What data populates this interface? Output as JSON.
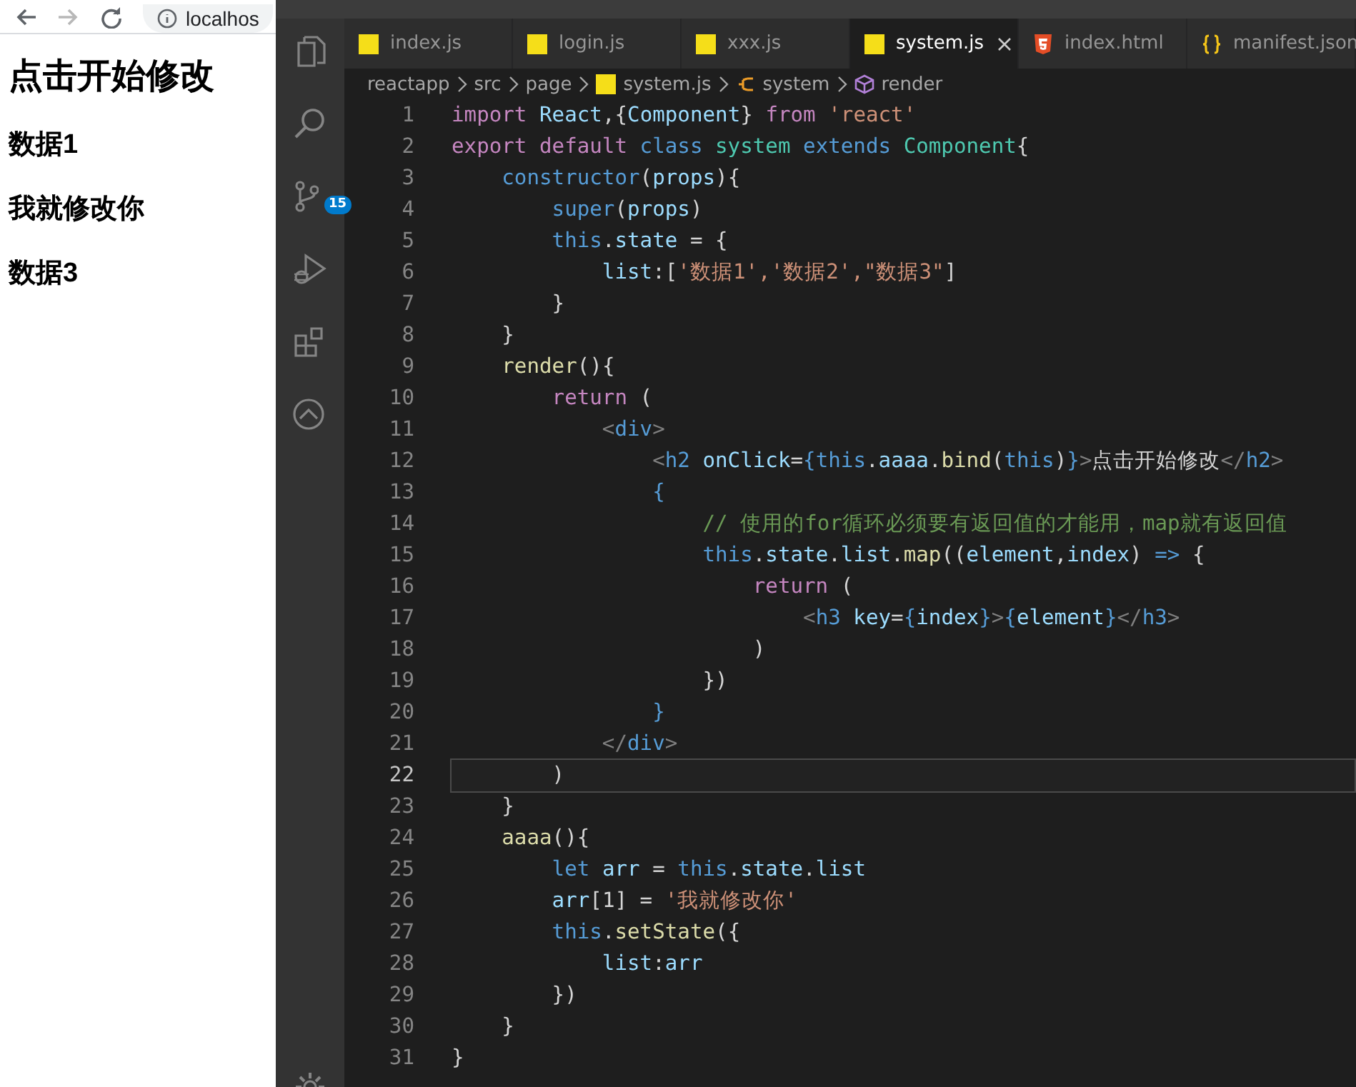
{
  "browser": {
    "nav_buttons": [
      {
        "kind": "back",
        "disabled": false
      },
      {
        "kind": "forward",
        "disabled": true
      },
      {
        "kind": "reload",
        "disabled": false
      }
    ],
    "address": "localhos",
    "heading": "点击开始修改",
    "items": [
      "数据1",
      "我就修改你",
      "数据3"
    ]
  },
  "editor": {
    "activity_bar": {
      "items": [
        {
          "kind": "files"
        },
        {
          "kind": "search"
        },
        {
          "kind": "git",
          "badge": "15"
        },
        {
          "kind": "debug"
        },
        {
          "kind": "extensions"
        },
        {
          "kind": "remote"
        }
      ]
    },
    "tabs": [
      {
        "label": "index.js",
        "kind": "js",
        "selected": false
      },
      {
        "label": "login.js",
        "kind": "js",
        "selected": false
      },
      {
        "label": "xxx.js",
        "kind": "js",
        "selected": false
      },
      {
        "label": "system.js",
        "kind": "js",
        "selected": true
      },
      {
        "label": "index.html",
        "kind": "html",
        "selected": false
      },
      {
        "label": "manifest.json",
        "kind": "json",
        "selected": false
      }
    ],
    "breadcrumb": [
      {
        "label": "reactapp",
        "kind": "folder"
      },
      {
        "label": "src",
        "kind": "folder"
      },
      {
        "label": "page",
        "kind": "folder"
      },
      {
        "label": "system.js",
        "kind": "js"
      },
      {
        "label": "system",
        "kind": "class"
      },
      {
        "label": "render",
        "kind": "method"
      }
    ],
    "lines": [
      {
        "number": "1",
        "current": false,
        "tokens": [
          {
            "text": "import ",
            "kind": "kw"
          },
          {
            "text": "React",
            "kind": "var"
          },
          {
            "text": ",{",
            "kind": "p"
          },
          {
            "text": "Component",
            "kind": "var"
          },
          {
            "text": "} ",
            "kind": "p"
          },
          {
            "text": "from ",
            "kind": "kw"
          },
          {
            "text": "'react'",
            "kind": "str"
          }
        ]
      },
      {
        "number": "2",
        "current": false,
        "tokens": [
          {
            "text": "export default ",
            "kind": "kw"
          },
          {
            "text": "class ",
            "kind": "st"
          },
          {
            "text": "system ",
            "kind": "type"
          },
          {
            "text": "extends ",
            "kind": "st"
          },
          {
            "text": "Component",
            "kind": "type"
          },
          {
            "text": "{",
            "kind": "p"
          }
        ]
      },
      {
        "number": "3",
        "current": false,
        "tokens": [
          {
            "text": "    constructor",
            "kind": "st"
          },
          {
            "text": "(",
            "kind": "p"
          },
          {
            "text": "props",
            "kind": "var"
          },
          {
            "text": "){",
            "kind": "p"
          }
        ]
      },
      {
        "number": "4",
        "current": false,
        "tokens": [
          {
            "text": "        super",
            "kind": "st"
          },
          {
            "text": "(",
            "kind": "p"
          },
          {
            "text": "props",
            "kind": "var"
          },
          {
            "text": ")",
            "kind": "p"
          }
        ]
      },
      {
        "number": "5",
        "current": false,
        "tokens": [
          {
            "text": "        this",
            "kind": "st"
          },
          {
            "text": ".",
            "kind": "p"
          },
          {
            "text": "state",
            "kind": "var"
          },
          {
            "text": " = {",
            "kind": "p"
          }
        ]
      },
      {
        "number": "6",
        "current": false,
        "tokens": [
          {
            "text": "            list",
            "kind": "var"
          },
          {
            "text": ":[",
            "kind": "p"
          },
          {
            "text": "'数据1','数据2',\"数据3\"",
            "kind": "str"
          },
          {
            "text": "]",
            "kind": "p"
          }
        ]
      },
      {
        "number": "7",
        "current": false,
        "tokens": [
          {
            "text": "        }",
            "kind": "p"
          }
        ]
      },
      {
        "number": "8",
        "current": false,
        "tokens": [
          {
            "text": "    }",
            "kind": "p"
          }
        ]
      },
      {
        "number": "9",
        "current": false,
        "tokens": [
          {
            "text": "    render",
            "kind": "fn"
          },
          {
            "text": "(){",
            "kind": "p"
          }
        ]
      },
      {
        "number": "10",
        "current": false,
        "tokens": [
          {
            "text": "        return",
            "kind": "kw"
          },
          {
            "text": " (",
            "kind": "p"
          }
        ]
      },
      {
        "number": "11",
        "current": false,
        "tokens": [
          {
            "text": "            <",
            "kind": "tag"
          },
          {
            "text": "div",
            "kind": "st"
          },
          {
            "text": ">",
            "kind": "tag"
          }
        ]
      },
      {
        "number": "12",
        "current": false,
        "tokens": [
          {
            "text": "                <",
            "kind": "tag"
          },
          {
            "text": "h2 ",
            "kind": "st"
          },
          {
            "text": "onClick",
            "kind": "var"
          },
          {
            "text": "=",
            "kind": "p"
          },
          {
            "text": "{this",
            "kind": "st"
          },
          {
            "text": ".",
            "kind": "p"
          },
          {
            "text": "aaaa",
            "kind": "var"
          },
          {
            "text": ".",
            "kind": "p"
          },
          {
            "text": "bind",
            "kind": "fn"
          },
          {
            "text": "(",
            "kind": "p"
          },
          {
            "text": "this",
            "kind": "st"
          },
          {
            "text": ")",
            "kind": "p"
          },
          {
            "text": "}",
            "kind": "st"
          },
          {
            "text": ">",
            "kind": "tag"
          },
          {
            "text": "点击开始修改",
            "kind": "p"
          },
          {
            "text": "</",
            "kind": "tag"
          },
          {
            "text": "h2",
            "kind": "st"
          },
          {
            "text": ">",
            "kind": "tag"
          }
        ]
      },
      {
        "number": "13",
        "current": false,
        "tokens": [
          {
            "text": "                {",
            "kind": "st"
          }
        ]
      },
      {
        "number": "14",
        "current": false,
        "tokens": [
          {
            "text": "                    // 使用的for循环必须要有返回值的才能用，map就有返回值",
            "kind": "cm"
          }
        ]
      },
      {
        "number": "15",
        "current": false,
        "tokens": [
          {
            "text": "                    this",
            "kind": "st"
          },
          {
            "text": ".",
            "kind": "p"
          },
          {
            "text": "state",
            "kind": "var"
          },
          {
            "text": ".",
            "kind": "p"
          },
          {
            "text": "list",
            "kind": "var"
          },
          {
            "text": ".",
            "kind": "p"
          },
          {
            "text": "map",
            "kind": "fn"
          },
          {
            "text": "((",
            "kind": "p"
          },
          {
            "text": "element",
            "kind": "var"
          },
          {
            "text": ",",
            "kind": "p"
          },
          {
            "text": "index",
            "kind": "var"
          },
          {
            "text": ") ",
            "kind": "p"
          },
          {
            "text": "=>",
            "kind": "st"
          },
          {
            "text": " {",
            "kind": "p"
          }
        ]
      },
      {
        "number": "16",
        "current": false,
        "tokens": [
          {
            "text": "                        return",
            "kind": "kw"
          },
          {
            "text": " (",
            "kind": "p"
          }
        ]
      },
      {
        "number": "17",
        "current": false,
        "tokens": [
          {
            "text": "                            <",
            "kind": "tag"
          },
          {
            "text": "h3 ",
            "kind": "st"
          },
          {
            "text": "key",
            "kind": "var"
          },
          {
            "text": "=",
            "kind": "p"
          },
          {
            "text": "{",
            "kind": "st"
          },
          {
            "text": "index",
            "kind": "var"
          },
          {
            "text": "}",
            "kind": "st"
          },
          {
            "text": ">",
            "kind": "tag"
          },
          {
            "text": "{",
            "kind": "st"
          },
          {
            "text": "element",
            "kind": "var"
          },
          {
            "text": "}",
            "kind": "st"
          },
          {
            "text": "</",
            "kind": "tag"
          },
          {
            "text": "h3",
            "kind": "st"
          },
          {
            "text": ">",
            "kind": "tag"
          }
        ]
      },
      {
        "number": "18",
        "current": false,
        "tokens": [
          {
            "text": "                        )",
            "kind": "p"
          }
        ]
      },
      {
        "number": "19",
        "current": false,
        "tokens": [
          {
            "text": "                    })",
            "kind": "p"
          }
        ]
      },
      {
        "number": "20",
        "current": false,
        "tokens": [
          {
            "text": "                }",
            "kind": "st"
          }
        ]
      },
      {
        "number": "21",
        "current": false,
        "tokens": [
          {
            "text": "            </",
            "kind": "tag"
          },
          {
            "text": "div",
            "kind": "st"
          },
          {
            "text": ">",
            "kind": "tag"
          }
        ]
      },
      {
        "number": "22",
        "current": true,
        "tokens": [
          {
            "text": "        )",
            "kind": "p"
          }
        ]
      },
      {
        "number": "23",
        "current": false,
        "tokens": [
          {
            "text": "    }",
            "kind": "p"
          }
        ]
      },
      {
        "number": "24",
        "current": false,
        "tokens": [
          {
            "text": "    aaaa",
            "kind": "fn"
          },
          {
            "text": "(){",
            "kind": "p"
          }
        ]
      },
      {
        "number": "25",
        "current": false,
        "tokens": [
          {
            "text": "        let ",
            "kind": "st"
          },
          {
            "text": "arr",
            "kind": "var"
          },
          {
            "text": " = ",
            "kind": "p"
          },
          {
            "text": "this",
            "kind": "st"
          },
          {
            "text": ".",
            "kind": "p"
          },
          {
            "text": "state",
            "kind": "var"
          },
          {
            "text": ".",
            "kind": "p"
          },
          {
            "text": "list",
            "kind": "var"
          }
        ]
      },
      {
        "number": "26",
        "current": false,
        "tokens": [
          {
            "text": "        arr",
            "kind": "var"
          },
          {
            "text": "[1] = ",
            "kind": "p"
          },
          {
            "text": "'我就修改你'",
            "kind": "str"
          }
        ]
      },
      {
        "number": "27",
        "current": false,
        "tokens": [
          {
            "text": "        this",
            "kind": "st"
          },
          {
            "text": ".",
            "kind": "p"
          },
          {
            "text": "setState",
            "kind": "fn"
          },
          {
            "text": "({",
            "kind": "p"
          }
        ]
      },
      {
        "number": "28",
        "current": false,
        "tokens": [
          {
            "text": "            list",
            "kind": "var"
          },
          {
            "text": ":",
            "kind": "p"
          },
          {
            "text": "arr",
            "kind": "var"
          }
        ]
      },
      {
        "number": "29",
        "current": false,
        "tokens": [
          {
            "text": "        })",
            "kind": "p"
          }
        ]
      },
      {
        "number": "30",
        "current": false,
        "tokens": [
          {
            "text": "    }",
            "kind": "p"
          }
        ]
      },
      {
        "number": "31",
        "current": false,
        "tokens": [
          {
            "text": "}",
            "kind": "p"
          }
        ]
      }
    ]
  }
}
